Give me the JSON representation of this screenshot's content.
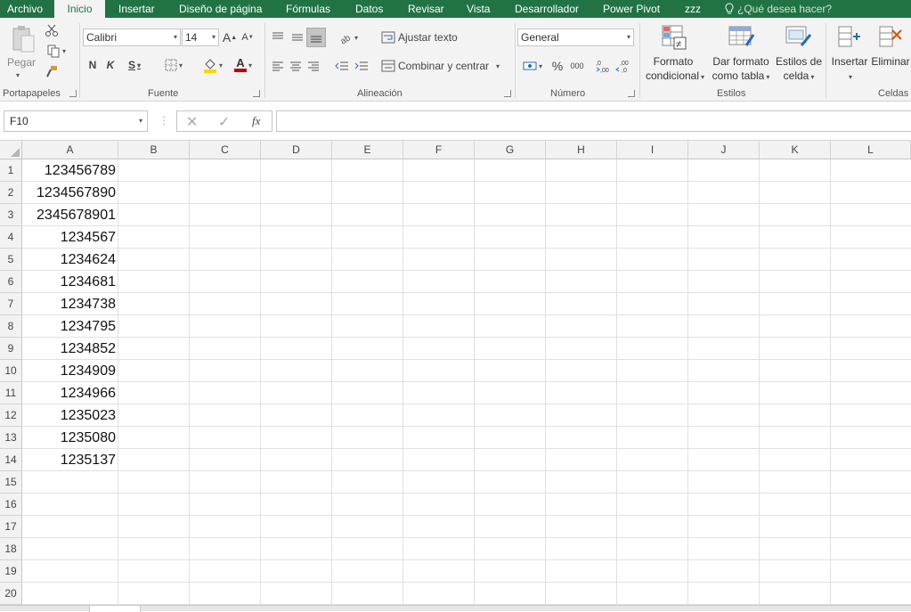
{
  "tabs": [
    "Archivo",
    "Inicio",
    "Insertar",
    "Diseño de página",
    "Fórmulas",
    "Datos",
    "Revisar",
    "Vista",
    "Desarrollador",
    "Power Pivot",
    "zzz"
  ],
  "active_tab": "Inicio",
  "tell_me": "¿Qué desea hacer?",
  "colors": {
    "brand": "#217346",
    "ribbon_bg": "#f3f3f3",
    "header_bg": "#f2f2f2",
    "gridline": "#e1e1e1"
  },
  "ribbon": {
    "clipboard": {
      "label": "Portapapeles",
      "paste": "Pegar"
    },
    "font": {
      "label": "Fuente",
      "name": "Calibri",
      "size": "14",
      "bold": "N",
      "italic": "K",
      "underline": "S",
      "grow": "A",
      "shrink": "A",
      "font_color": "A"
    },
    "alignment": {
      "label": "Alineación",
      "wrap": "Ajustar texto",
      "merge": "Combinar y centrar"
    },
    "number": {
      "label": "Número",
      "format": "General",
      "percent": "%",
      "thousands": "000"
    },
    "styles": {
      "label": "Estilos",
      "conditional_1": "Formato",
      "conditional_2": "condicional",
      "table_1": "Dar formato",
      "table_2": "como tabla",
      "cell_1": "Estilos de",
      "cell_2": "celda"
    },
    "cells": {
      "label": "Celdas",
      "insert": "Insertar",
      "delete": "Eliminar"
    }
  },
  "formula_bar": {
    "name_box": "F10",
    "fx": "fx",
    "value": ""
  },
  "columns": [
    "A",
    "B",
    "C",
    "D",
    "E",
    "F",
    "G",
    "H",
    "I",
    "J",
    "K",
    "L"
  ],
  "rows": [
    "1",
    "2",
    "3",
    "4",
    "5",
    "6",
    "7",
    "8",
    "9",
    "10",
    "11",
    "12",
    "13",
    "14",
    "15",
    "16",
    "17",
    "18",
    "19",
    "20"
  ],
  "column_a_values": [
    "123456789",
    "1234567890",
    "2345678901",
    "1234567",
    "1234624",
    "1234681",
    "1234738",
    "1234795",
    "1234852",
    "1234909",
    "1234966",
    "1235023",
    "1235080",
    "1235137"
  ]
}
